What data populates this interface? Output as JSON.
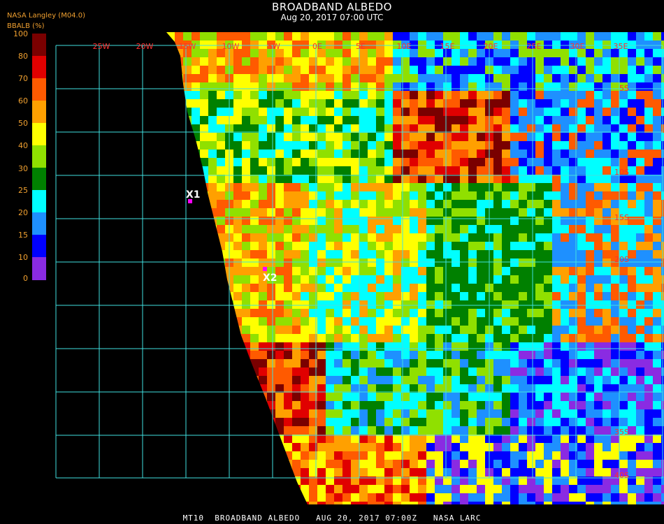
{
  "header": {
    "title": "BROADBAND ALBEDO",
    "subtitle": "Aug 20, 2017 07:00 UTC",
    "organization": "NASA Langley (M04.0)",
    "units": "BBALB (%)"
  },
  "colorbar": {
    "labels": [
      "100",
      "80",
      "70",
      "60",
      "50",
      "40",
      "30",
      "25",
      "20",
      "15",
      "10",
      "0"
    ],
    "colors": [
      "#7a0000",
      "#e00000",
      "#ff5a00",
      "#ffa000",
      "#ffff00",
      "#90e000",
      "#008000",
      "#00ffff",
      "#1e90ff",
      "#0000ff",
      "#8a2be2"
    ]
  },
  "map": {
    "lon_labels": [
      "25W",
      "20W",
      "15W",
      "10W",
      "5W",
      "0E",
      "5E",
      "10E",
      "15E",
      "20E",
      "25E",
      "30E",
      "35E"
    ],
    "lat_labels": [
      "5S",
      "10S",
      "15S",
      "20S",
      "35S",
      "40S"
    ],
    "markers": [
      {
        "label": "X1",
        "color": "#ff00ff"
      },
      {
        "label": "X2",
        "color": "#ff00ff"
      }
    ],
    "grid_color": "#40e0e0"
  },
  "footer": {
    "text": "MT10  BROADBAND ALBEDO   AUG 20, 2017 07:00Z   NASA LARC"
  }
}
